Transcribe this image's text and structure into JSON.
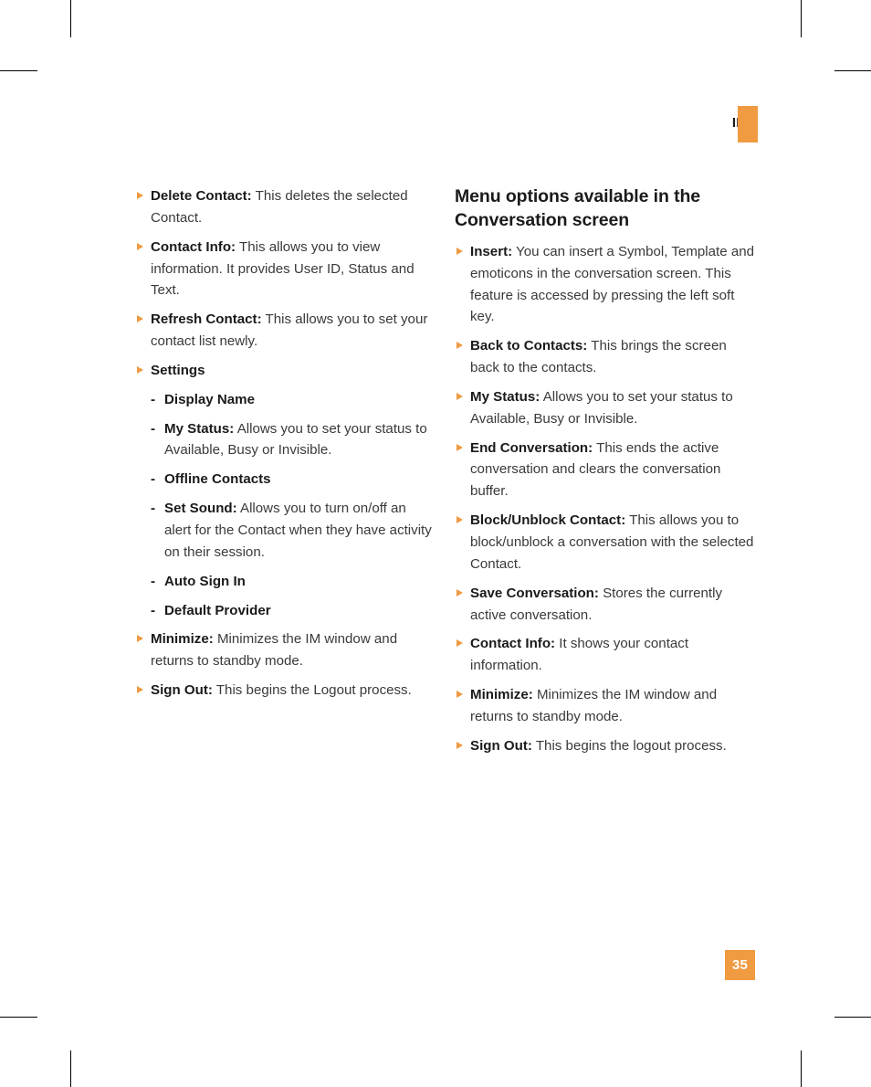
{
  "page": {
    "running_head": "IM",
    "folio": "35",
    "accent_color": "#F09A42",
    "text_color": "#3a3a3a",
    "label_color": "#1a1a1a"
  },
  "left_column": {
    "items": [
      {
        "marker": "triangle",
        "label": "Delete Contact:",
        "text": " This deletes the selected Contact."
      },
      {
        "marker": "triangle",
        "label": "Contact Info:",
        "text": " This allows you to view information. It provides User ID, Status and Text."
      },
      {
        "marker": "triangle",
        "label": "Refresh Contact:",
        "text": " This allows you to set your contact list newly."
      },
      {
        "marker": "triangle",
        "label": "Settings",
        "text": ""
      },
      {
        "marker": "dash",
        "dash": "-",
        "label": "Display Name",
        "text": ""
      },
      {
        "marker": "dash",
        "dash": "-",
        "label": "My Status:",
        "text": " Allows you to set your status to Available, Busy or Invisible."
      },
      {
        "marker": "dash",
        "dash": "-",
        "label": "Offline Contacts",
        "text": ""
      },
      {
        "marker": "dash",
        "dash": "-",
        "label": "Set Sound:",
        "text": " Allows you to turn on/off an alert for the Contact when they have activity on their session."
      },
      {
        "marker": "dash",
        "dash": "-",
        "label": "Auto Sign In",
        "text": ""
      },
      {
        "marker": "dash",
        "dash": "-",
        "label": "Default Provider",
        "text": ""
      },
      {
        "marker": "triangle",
        "label": "Minimize:",
        "text": " Minimizes the IM window and returns to standby mode."
      },
      {
        "marker": "triangle",
        "label": "Sign Out:",
        "text": " This begins the Logout process."
      }
    ]
  },
  "right_column": {
    "heading": "Menu options available in the Conversation screen",
    "items": [
      {
        "marker": "triangle",
        "label": "Insert:",
        "text": " You can insert a Symbol, Template and emoticons in the conversation screen. This feature is accessed by pressing the left soft key."
      },
      {
        "marker": "triangle",
        "label": "Back to Contacts:",
        "text": " This brings the screen back to the contacts."
      },
      {
        "marker": "triangle",
        "label": "My Status:",
        "text": " Allows you to set your status to Available, Busy or Invisible."
      },
      {
        "marker": "triangle",
        "label": "End Conversation:",
        "text": " This ends the active conversation and clears the conversation buffer."
      },
      {
        "marker": "triangle",
        "label": "Block/Unblock Contact:",
        "text": " This allows you to block/unblock a conversation with the selected Contact."
      },
      {
        "marker": "triangle",
        "label": "Save Conversation:",
        "text": " Stores the currently active conversation."
      },
      {
        "marker": "triangle",
        "label": "Contact Info:",
        "text": " It shows your contact information."
      },
      {
        "marker": "triangle",
        "label": "Minimize:",
        "text": " Minimizes the IM window and returns to standby mode."
      },
      {
        "marker": "triangle",
        "label": "Sign Out:",
        "text": " This begins the logout process."
      }
    ]
  }
}
